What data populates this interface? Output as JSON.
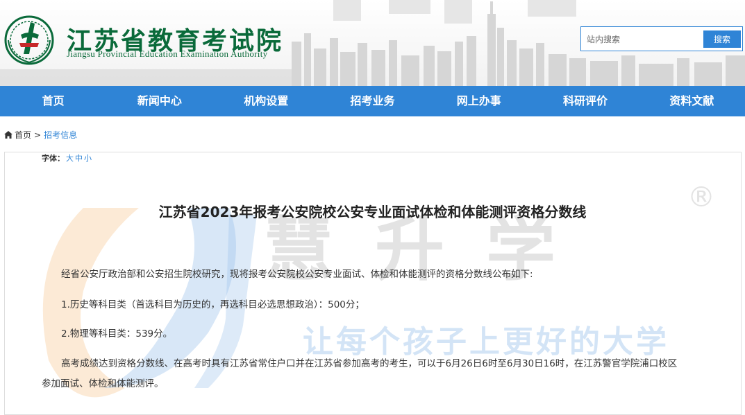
{
  "site": {
    "name_cn": "江苏省教育考试院",
    "name_en": "Jiangsu Provincial Education Examination Authority",
    "emblem_icon": "jseea-logo-icon"
  },
  "search": {
    "placeholder": "站内搜索",
    "button_label": "搜索"
  },
  "nav": {
    "items": [
      "首页",
      "新闻中心",
      "机构设置",
      "招考业务",
      "网上办事",
      "科研评价",
      "资料文献"
    ]
  },
  "breadcrumb": {
    "home": "首页",
    "separator": ">",
    "current": "招考信息"
  },
  "font_size": {
    "label": "字体：",
    "large": "大",
    "medium": "中",
    "small": "小"
  },
  "article": {
    "title": "江苏省2023年报考公安院校公安专业面试体检和体能测评资格分数线",
    "intro": "经省公安厅政治部和公安招生院校研究，现将报考公安院校公安专业面试、体检和体能测评的资格分数线公布如下:",
    "item1": "1.历史等科目类（首选科目为历史的，再选科目必选思想政治）：500分；",
    "item2": "2.物理等科目类：539分。",
    "para_line1": "高考成绩达到资格分数线、在高考时具有江苏省常住户口并在江苏省参加高考的考生，可以于6月26日6时至6月30日16时，在江苏警官学院浦口校区",
    "para_line2": "参加面试、体检和体能测评。"
  },
  "watermark": {
    "brand": "慧升学",
    "slogan": "让每个孩子上更好的大学",
    "registered": "®"
  },
  "colors": {
    "brand_green": "#0a6a3a",
    "nav_blue": "#2f84d6"
  }
}
